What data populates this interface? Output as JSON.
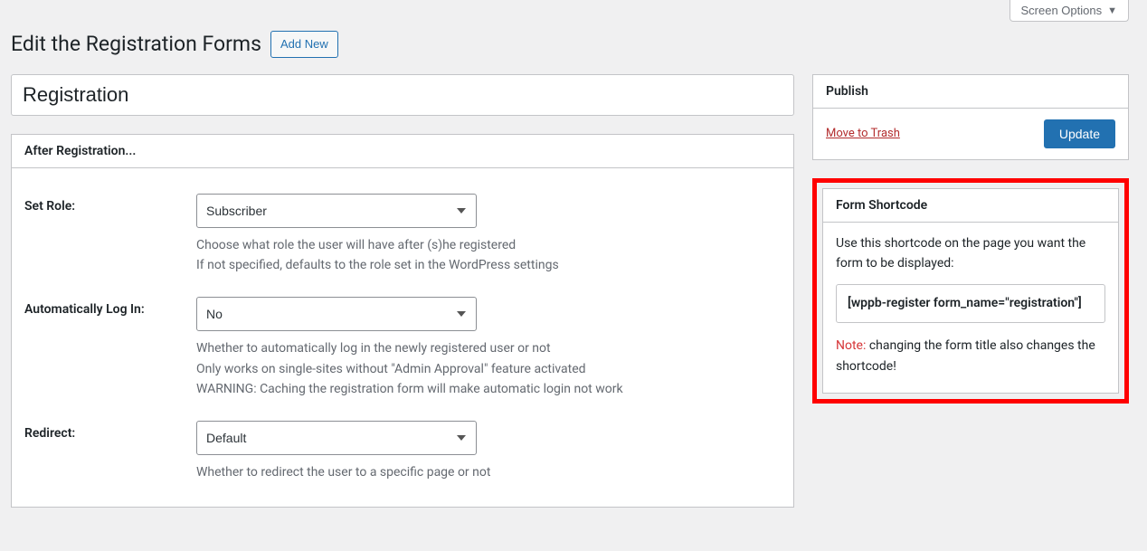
{
  "screen_options_label": "Screen Options",
  "page_title": "Edit the Registration Forms",
  "add_new_label": "Add New",
  "form_title": "Registration",
  "main_box": {
    "heading": "After Registration...",
    "fields": {
      "set_role": {
        "label": "Set Role:",
        "value": "Subscriber",
        "desc_line1": "Choose what role the user will have after (s)he registered",
        "desc_line2": "If not specified, defaults to the role set in the WordPress settings"
      },
      "auto_login": {
        "label": "Automatically Log In:",
        "value": "No",
        "desc_line1": "Whether to automatically log in the newly registered user or not",
        "desc_line2": "Only works on single-sites without \"Admin Approval\" feature activated",
        "desc_line3": "WARNING: Caching the registration form will make automatic login not work"
      },
      "redirect": {
        "label": "Redirect:",
        "value": "Default",
        "desc_line1": "Whether to redirect the user to a specific page or not"
      }
    }
  },
  "publish": {
    "heading": "Publish",
    "trash_label": "Move to Trash",
    "update_label": "Update"
  },
  "shortcode": {
    "heading": "Form Shortcode",
    "intro": "Use this shortcode on the page you want the form to be displayed:",
    "code": "[wppb-register form_name=\"registration\"]",
    "note_label": "Note:",
    "note_text": " changing the form title also changes the shortcode!"
  }
}
